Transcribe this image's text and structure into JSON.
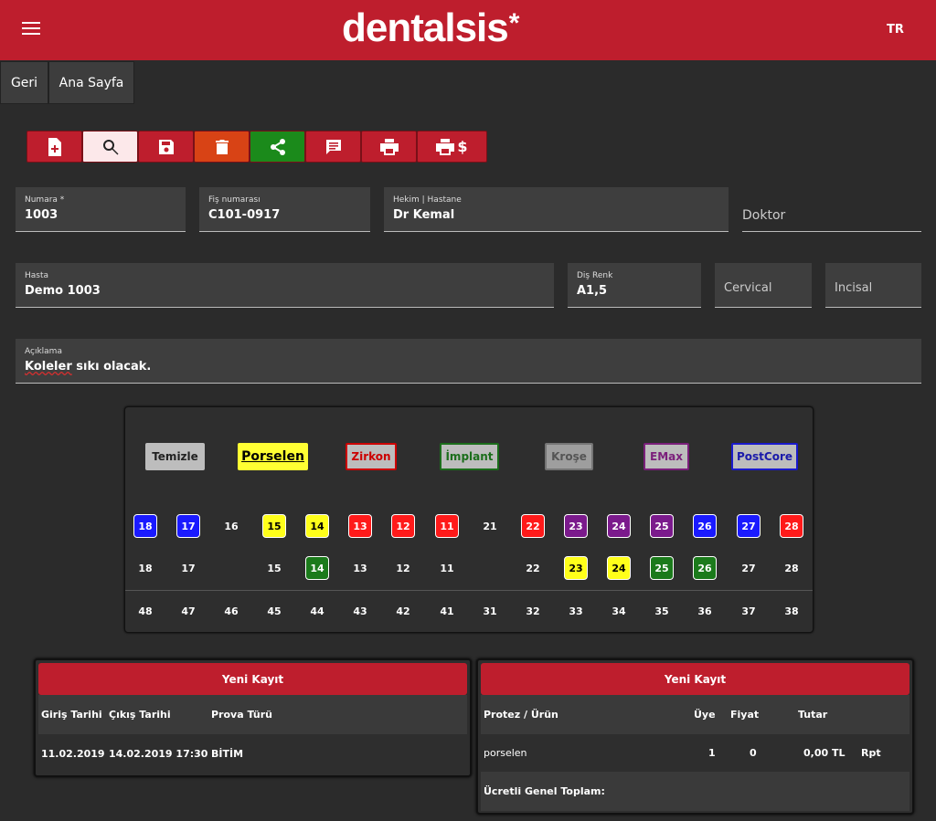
{
  "header": {
    "logo": "dentalsis",
    "logo_mark": "*",
    "lang": "TR"
  },
  "nav": {
    "back": "Geri",
    "home": "Ana Sayfa"
  },
  "toolbar": [
    {
      "icon": "add-document-icon"
    },
    {
      "icon": "search-icon"
    },
    {
      "icon": "save-icon"
    },
    {
      "icon": "delete-icon"
    },
    {
      "icon": "share-icon"
    },
    {
      "icon": "message-icon"
    },
    {
      "icon": "print-icon"
    },
    {
      "icon": "print-price-icon",
      "suffix": "$"
    }
  ],
  "form": {
    "numara": {
      "label": "Numara *",
      "value": "1003"
    },
    "fis": {
      "label": "Fiş numarası",
      "value": "C101-0917"
    },
    "hekim": {
      "label": "Hekim | Hastane",
      "value": "Dr Kemal"
    },
    "doktor": {
      "placeholder": "Doktor"
    },
    "hasta": {
      "label": "Hasta",
      "value": "Demo 1003"
    },
    "dis_renk": {
      "label": "Diş Renk",
      "value": "A1,5"
    },
    "cervical": {
      "placeholder": "Cervical"
    },
    "incisal": {
      "placeholder": "Incisal"
    },
    "aciklama": {
      "label": "Açıklama",
      "value_underlined": "Koleler",
      "value_rest": " sıkı olacak."
    }
  },
  "legend": [
    {
      "label": "Temizle",
      "bg": "#bdbdbd",
      "fg": "#222222",
      "border": "#bdbdbd"
    },
    {
      "label": "Porselen",
      "bg": "#ffff33",
      "fg": "#000000",
      "border": "#ffff33"
    },
    {
      "label": "Zirkon",
      "bg": "#bdbdbd",
      "fg": "#cc0000",
      "border": "#cc0000"
    },
    {
      "label": "İmplant",
      "bg": "#bdbdbd",
      "fg": "#1b6e1b",
      "border": "#1b6e1b"
    },
    {
      "label": "Kroşe",
      "bg": "#9e9e9e",
      "fg": "#555555",
      "border": "#757575"
    },
    {
      "label": "EMax",
      "bg": "#bdbdbd",
      "fg": "#7b1f7b",
      "border": "#7b1f7b"
    },
    {
      "label": "PostCore",
      "bg": "#bdbdbd",
      "fg": "#1a1aaa",
      "border": "#1a1acc"
    }
  ],
  "colors": {
    "blue": "#1a1aff",
    "yellow": "#ffff1a",
    "red": "#ff1a1a",
    "purple": "#7b1a8c",
    "green": "#1b7a1b",
    "none": "transparent"
  },
  "teeth": {
    "row1": [
      {
        "n": "18",
        "c": "blue"
      },
      {
        "n": "17",
        "c": "blue"
      },
      {
        "n": "16",
        "c": "none"
      },
      {
        "n": "15",
        "c": "yellow"
      },
      {
        "n": "14",
        "c": "yellow"
      },
      {
        "n": "13",
        "c": "red"
      },
      {
        "n": "12",
        "c": "red"
      },
      {
        "n": "11",
        "c": "red"
      },
      {
        "n": "21",
        "c": "none"
      },
      {
        "n": "22",
        "c": "red"
      },
      {
        "n": "23",
        "c": "purple"
      },
      {
        "n": "24",
        "c": "purple"
      },
      {
        "n": "25",
        "c": "purple"
      },
      {
        "n": "26",
        "c": "blue"
      },
      {
        "n": "27",
        "c": "blue"
      },
      {
        "n": "28",
        "c": "red"
      }
    ],
    "row2": [
      {
        "n": "18",
        "c": "none"
      },
      {
        "n": "17",
        "c": "none"
      },
      {
        "n": "",
        "c": "none"
      },
      {
        "n": "15",
        "c": "none"
      },
      {
        "n": "14",
        "c": "green"
      },
      {
        "n": "13",
        "c": "none"
      },
      {
        "n": "12",
        "c": "none"
      },
      {
        "n": "11",
        "c": "none"
      },
      {
        "n": "",
        "c": "none"
      },
      {
        "n": "22",
        "c": "none"
      },
      {
        "n": "23",
        "c": "yellow"
      },
      {
        "n": "24",
        "c": "yellow"
      },
      {
        "n": "25",
        "c": "green"
      },
      {
        "n": "26",
        "c": "green"
      },
      {
        "n": "27",
        "c": "none"
      },
      {
        "n": "28",
        "c": "none"
      }
    ],
    "row3": [
      {
        "n": "48",
        "c": "none"
      },
      {
        "n": "47",
        "c": "none"
      },
      {
        "n": "46",
        "c": "none"
      },
      {
        "n": "45",
        "c": "none"
      },
      {
        "n": "44",
        "c": "none"
      },
      {
        "n": "43",
        "c": "none"
      },
      {
        "n": "42",
        "c": "none"
      },
      {
        "n": "41",
        "c": "none"
      },
      {
        "n": "31",
        "c": "none"
      },
      {
        "n": "32",
        "c": "none"
      },
      {
        "n": "33",
        "c": "none"
      },
      {
        "n": "34",
        "c": "none"
      },
      {
        "n": "35",
        "c": "none"
      },
      {
        "n": "36",
        "c": "none"
      },
      {
        "n": "37",
        "c": "none"
      },
      {
        "n": "38",
        "c": "none"
      }
    ]
  },
  "left_panel": {
    "title": "Yeni Kayıt",
    "headers": [
      "Giriş Tarihi",
      "Çıkış Tarihi",
      "Prova Türü"
    ],
    "rows": [
      [
        "11.02.2019",
        "14.02.2019 17:30",
        "BİTİM"
      ]
    ]
  },
  "right_panel": {
    "title": "Yeni Kayıt",
    "headers": [
      "Protez / Ürün",
      "Üye",
      "Fiyat",
      "Tutar"
    ],
    "rows": [
      [
        "porselen",
        "1",
        "0",
        "0,00 TL",
        "Rpt"
      ]
    ],
    "total_label": "Ücretli Genel Toplam:"
  }
}
